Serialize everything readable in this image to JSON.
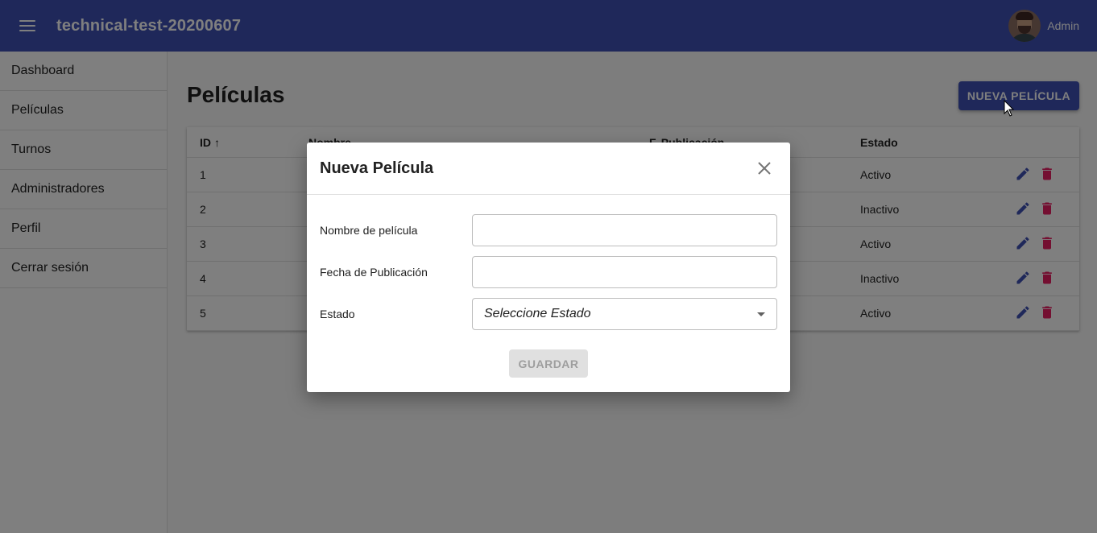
{
  "app": {
    "title": "technical-test-20200607",
    "user_name": "Admin"
  },
  "sidebar": {
    "items": [
      {
        "label": "Dashboard"
      },
      {
        "label": "Películas"
      },
      {
        "label": "Turnos"
      },
      {
        "label": "Administradores"
      },
      {
        "label": "Perfil"
      },
      {
        "label": "Cerrar sesión"
      }
    ]
  },
  "page": {
    "title": "Películas",
    "new_button": "NUEVA PELÍCULA"
  },
  "table": {
    "headers": {
      "id": "ID",
      "name": "Nombre",
      "date": "F. Publicación",
      "status": "Estado"
    },
    "sort_icon": "↑",
    "rows": [
      {
        "id": "1",
        "status": "Activo"
      },
      {
        "id": "2",
        "status": "Inactivo"
      },
      {
        "id": "3",
        "status": "Activo"
      },
      {
        "id": "4",
        "status": "Inactivo"
      },
      {
        "id": "5",
        "status": "Activo"
      }
    ]
  },
  "modal": {
    "title": "Nueva Película",
    "fields": {
      "name_label": "Nombre de película",
      "name_value": "",
      "date_label": "Fecha de Publicación",
      "date_value": "",
      "status_label": "Estado",
      "status_selected": "Seleccione Estado"
    },
    "save_button": "GUARDAR"
  },
  "icons": {
    "menu": "menu-icon",
    "close": "close-icon",
    "edit": "edit-icon",
    "delete": "delete-icon",
    "caret": "chevron-down-icon",
    "cursor": "mouse-cursor-icon"
  },
  "colors": {
    "primary": "#3f51b5",
    "danger": "#e91e63",
    "disabled_bg": "#e0e0e0",
    "disabled_text": "#9e9e9e"
  }
}
